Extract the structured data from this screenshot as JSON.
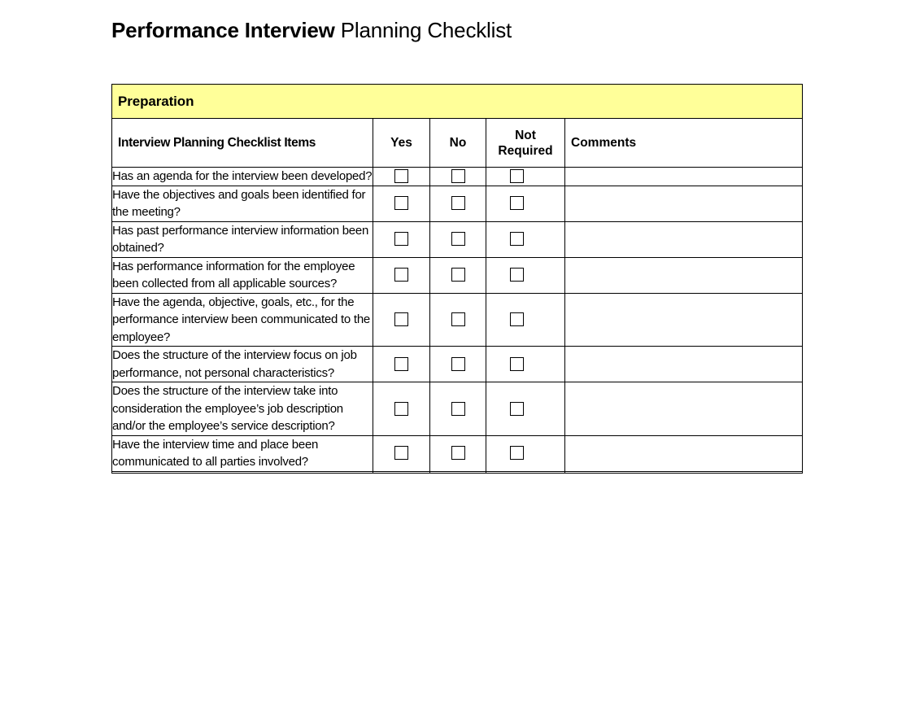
{
  "title": {
    "bold_part": "Performance Interview",
    "regular_part": " Planning Checklist"
  },
  "table": {
    "section_banner": "Preparation",
    "columns": {
      "item": "Interview Planning Checklist Items",
      "yes": "Yes",
      "no": "No",
      "not_required_line1": "Not",
      "not_required_line2": "Required",
      "comments": "Comments"
    },
    "rows": [
      {
        "item": "Has an agenda for the interview been developed?",
        "yes": "",
        "no": "",
        "not_required": "",
        "comments": ""
      },
      {
        "item": "Have the objectives and goals been identified for the meeting?",
        "yes": "",
        "no": "",
        "not_required": "",
        "comments": ""
      },
      {
        "item": "Has past performance interview information been obtained?",
        "yes": "",
        "no": "",
        "not_required": "",
        "comments": ""
      },
      {
        "item": "Has performance information for the employee been collected from all applicable sources?",
        "yes": "",
        "no": "",
        "not_required": "",
        "comments": ""
      },
      {
        "item": "Have the agenda, objective, goals, etc., for the performance interview been communicated to the employee?",
        "yes": "",
        "no": "",
        "not_required": "",
        "comments": ""
      },
      {
        "item": "Does the structure of the interview focus on job performance, not personal characteristics?",
        "yes": "",
        "no": "",
        "not_required": "",
        "comments": ""
      },
      {
        "item": "Does the structure of the interview take into consideration the employee’s job description and/or the employee’s service description?",
        "yes": "",
        "no": "",
        "not_required": "",
        "comments": ""
      },
      {
        "item": "Have the interview time and place been communicated to all parties involved?",
        "yes": "",
        "no": "",
        "not_required": "",
        "comments": ""
      },
      {
        "item": "",
        "yes": "",
        "no": "",
        "not_required": "",
        "comments": ""
      }
    ]
  },
  "colors": {
    "banner_yellow": "#ffff99",
    "border": "#000000",
    "page_background": "#ffffff",
    "text": "#000000"
  }
}
